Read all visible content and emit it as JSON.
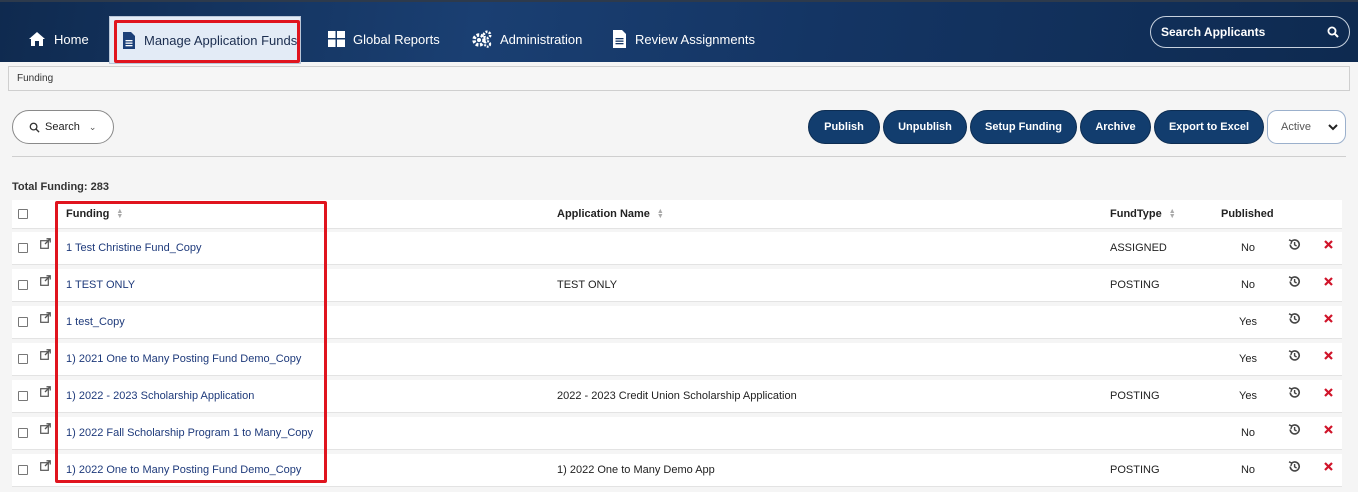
{
  "nav": {
    "home": "Home",
    "manage": "Manage Application Funds",
    "reports": "Global Reports",
    "admin": "Administration",
    "review": "Review Assignments",
    "search_placeholder": "Search Applicants"
  },
  "breadcrumb": "Funding",
  "toolbar": {
    "search": "Search",
    "publish": "Publish",
    "unpublish": "Unpublish",
    "setup": "Setup Funding",
    "archive": "Archive",
    "export": "Export to Excel",
    "status": "Active"
  },
  "total_label": "Total Funding: 283",
  "columns": {
    "funding": "Funding",
    "app_name": "Application Name",
    "fund_type": "FundType",
    "published": "Published"
  },
  "rows": [
    {
      "funding": "1 Test Christine Fund_Copy",
      "app": "",
      "type": "ASSIGNED",
      "published": "No"
    },
    {
      "funding": "1 TEST ONLY",
      "app": "TEST ONLY",
      "type": "POSTING",
      "published": "No"
    },
    {
      "funding": "1 test_Copy",
      "app": "",
      "type": "",
      "published": "Yes"
    },
    {
      "funding": "1) 2021 One to Many Posting Fund Demo_Copy",
      "app": "",
      "type": "",
      "published": "Yes"
    },
    {
      "funding": "1) 2022 - 2023 Scholarship Application",
      "app": "2022 - 2023 Credit Union Scholarship Application",
      "type": "POSTING",
      "published": "Yes"
    },
    {
      "funding": "1) 2022 Fall Scholarship Program 1 to Many_Copy",
      "app": "",
      "type": "",
      "published": "No"
    },
    {
      "funding": "1) 2022 One to Many Posting Fund Demo_Copy",
      "app": "1) 2022 One to Many Demo App",
      "type": "POSTING",
      "published": "No"
    }
  ],
  "colors": {
    "nav_bg": "#143564",
    "button": "#123d6e",
    "highlight": "#e0141e",
    "delete": "#d0142a",
    "link": "#1e3a7b"
  }
}
